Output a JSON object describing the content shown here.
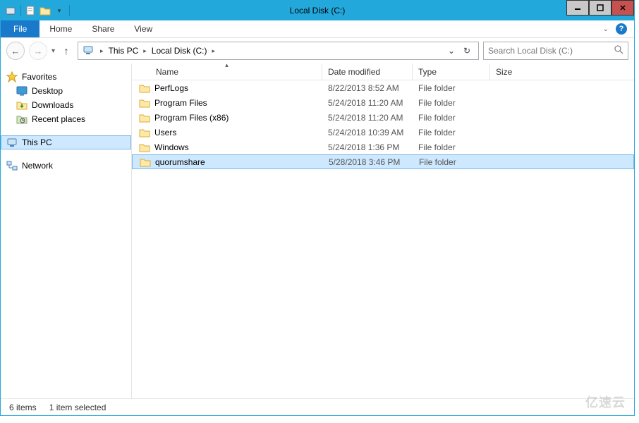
{
  "window": {
    "title": "Local Disk (C:)"
  },
  "ribbon": {
    "file": "File",
    "home": "Home",
    "share": "Share",
    "view": "View"
  },
  "breadcrumb": {
    "seg1": "This PC",
    "seg2": "Local Disk (C:)"
  },
  "search": {
    "placeholder": "Search Local Disk (C:)"
  },
  "nav": {
    "favorites": "Favorites",
    "desktop": "Desktop",
    "downloads": "Downloads",
    "recent": "Recent places",
    "thispc": "This PC",
    "network": "Network"
  },
  "columns": {
    "name": "Name",
    "date": "Date modified",
    "type": "Type",
    "size": "Size"
  },
  "files": [
    {
      "name": "PerfLogs",
      "date": "8/22/2013 8:52 AM",
      "type": "File folder",
      "size": "",
      "selected": false
    },
    {
      "name": "Program Files",
      "date": "5/24/2018 11:20 AM",
      "type": "File folder",
      "size": "",
      "selected": false
    },
    {
      "name": "Program Files (x86)",
      "date": "5/24/2018 11:20 AM",
      "type": "File folder",
      "size": "",
      "selected": false
    },
    {
      "name": "Users",
      "date": "5/24/2018 10:39 AM",
      "type": "File folder",
      "size": "",
      "selected": false
    },
    {
      "name": "Windows",
      "date": "5/24/2018 1:36 PM",
      "type": "File folder",
      "size": "",
      "selected": false
    },
    {
      "name": "quorumshare",
      "date": "5/28/2018 3:46 PM",
      "type": "File folder",
      "size": "",
      "selected": true
    }
  ],
  "status": {
    "items": "6 items",
    "selected": "1 item selected"
  },
  "watermark": "亿速云"
}
